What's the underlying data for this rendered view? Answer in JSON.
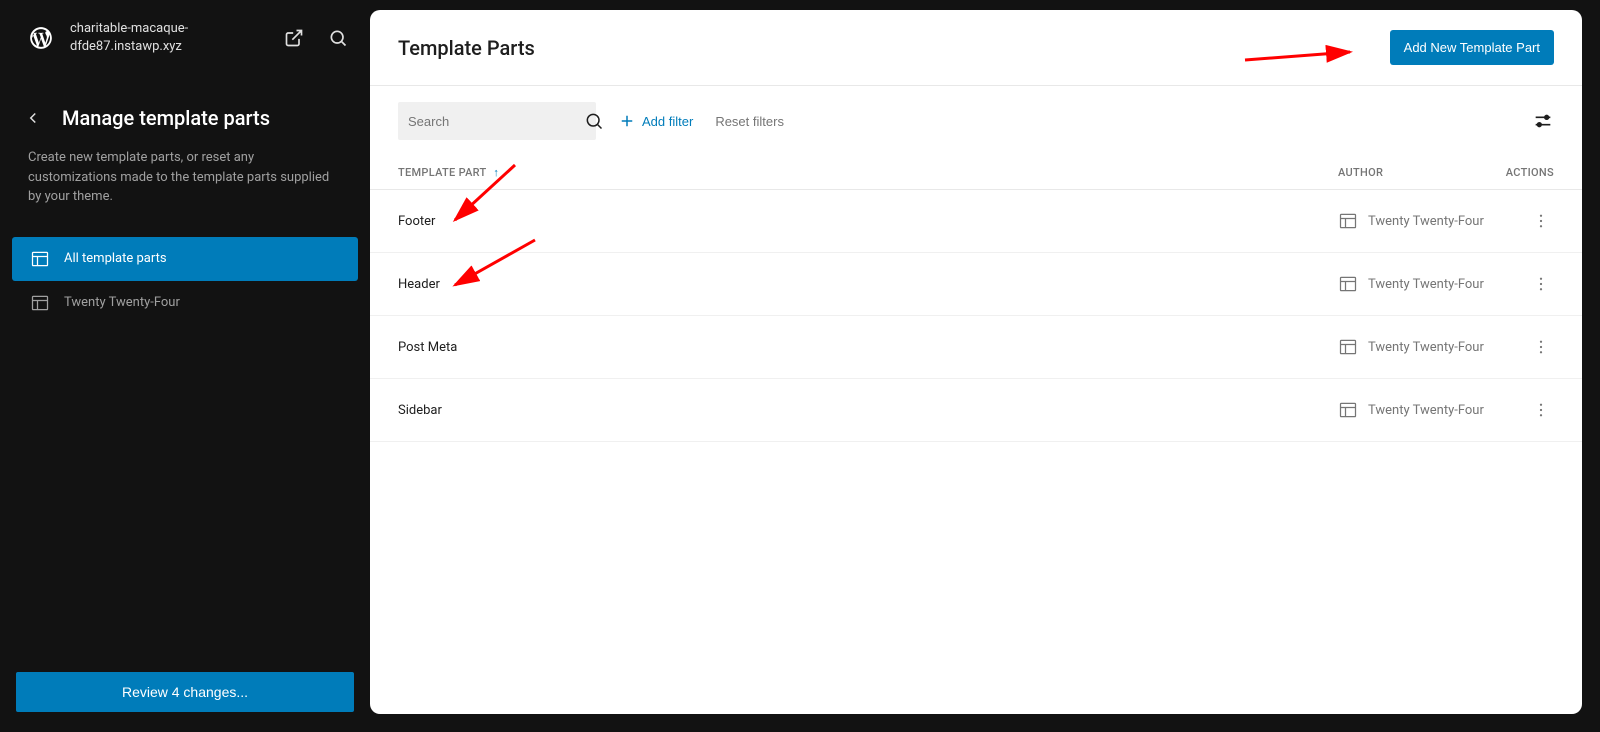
{
  "header": {
    "site_name": "charitable-macaque-dfde87.instawp.xyz"
  },
  "sidebar": {
    "title": "Manage template parts",
    "description": "Create new template parts, or reset any customizations made to the template parts supplied by your theme.",
    "items": [
      {
        "label": "All template parts",
        "active": true
      },
      {
        "label": "Twenty Twenty-Four",
        "active": false
      }
    ],
    "review_button": "Review 4 changes..."
  },
  "panel": {
    "title": "Template Parts",
    "add_button": "Add New Template Part",
    "search_placeholder": "Search",
    "add_filter": "Add filter",
    "reset_filters": "Reset filters",
    "columns": {
      "name": "Template Part",
      "author": "Author",
      "actions": "Actions"
    },
    "rows": [
      {
        "name": "Footer",
        "author": "Twenty Twenty-Four"
      },
      {
        "name": "Header",
        "author": "Twenty Twenty-Four"
      },
      {
        "name": "Post Meta",
        "author": "Twenty Twenty-Four"
      },
      {
        "name": "Sidebar",
        "author": "Twenty Twenty-Four"
      }
    ]
  }
}
